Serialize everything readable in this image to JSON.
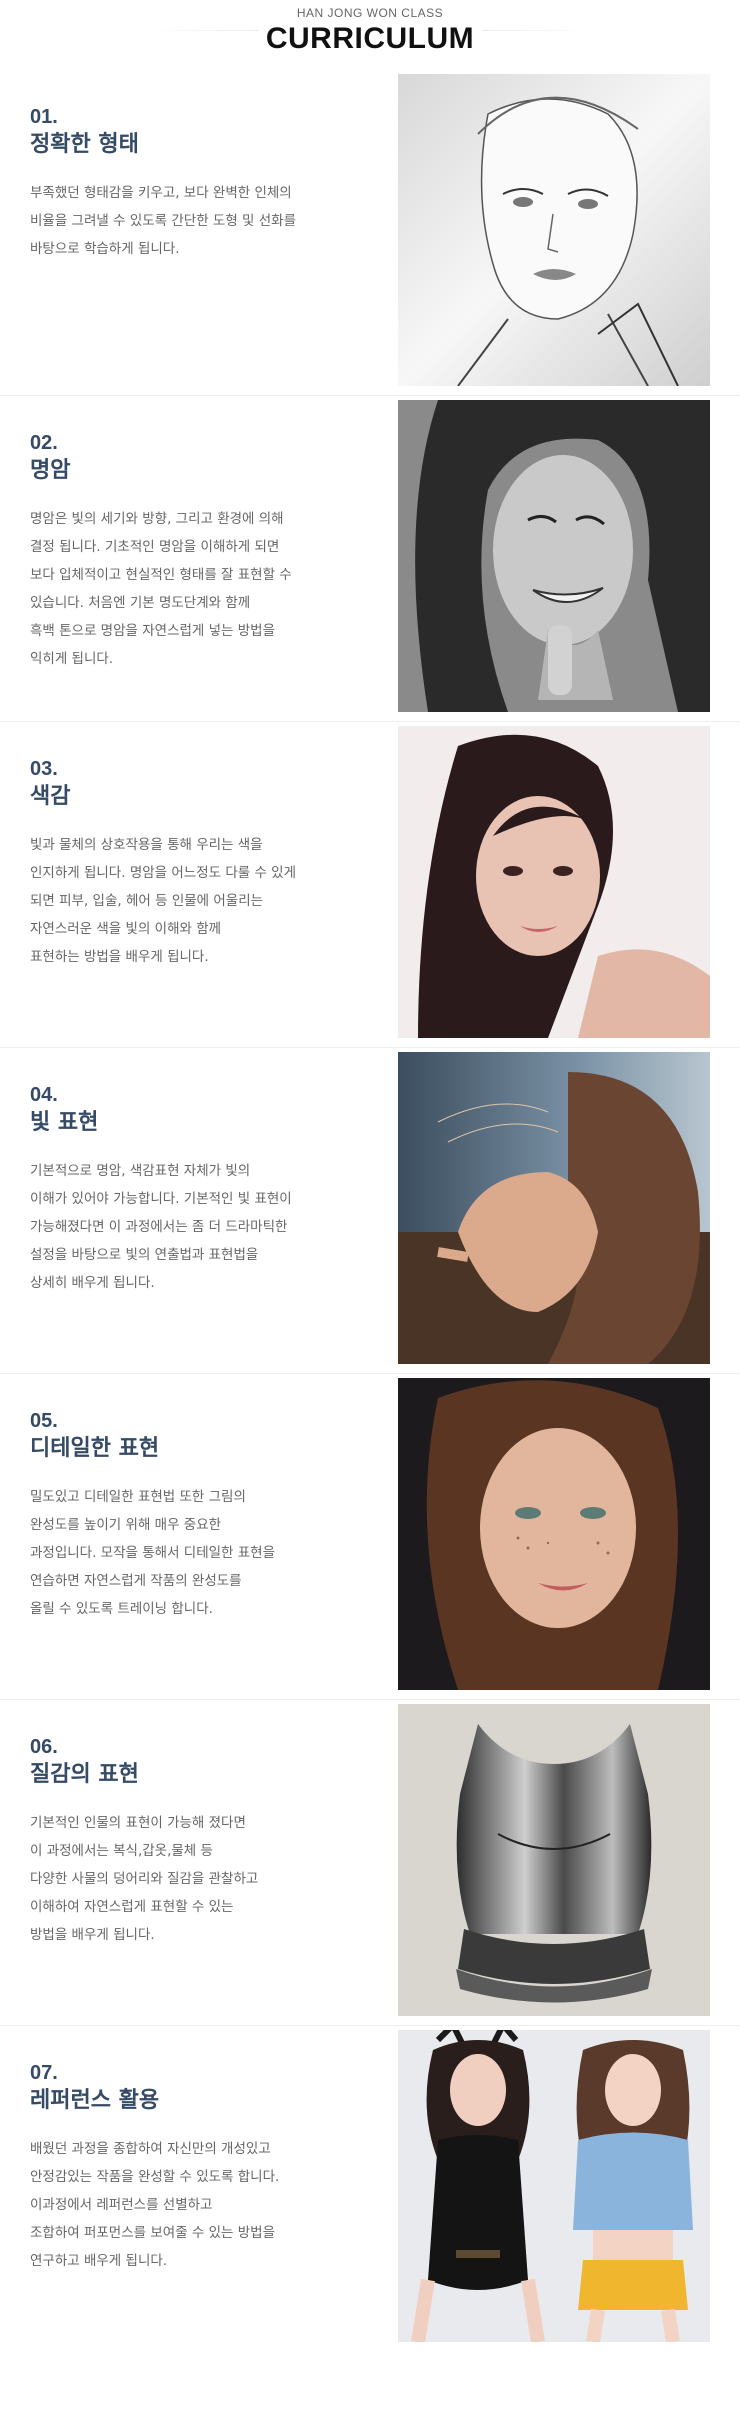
{
  "header": {
    "subtitle": "HAN JONG WON CLASS",
    "title": "CURRICULUM"
  },
  "sections": [
    {
      "number": "01.",
      "title": "정확한 형태",
      "description": "부족했던 형태감을 키우고, 보다 완벽한 인체의\n비율을 그려낼 수 있도록  간단한 도형 및 선화를\n바탕으로 학습하게 됩니다.",
      "image": "pencil-sketch-portrait"
    },
    {
      "number": "02.",
      "title": "명암",
      "description": "명암은 빛의 세기와 방향, 그리고 환경에 의해\n결정 됩니다. 기초적인 명암을 이해하게 되면\n보다 입체적이고 현실적인 형태를 잘 표현할 수\n있습니다.  처음엔 기본 명도단계와 함께\n흑백 톤으로 명암을 자연스럽게 넣는 방법을\n익히게 됩니다.",
      "image": "grayscale-smiling-portrait"
    },
    {
      "number": "03.",
      "title": "색감",
      "description": "빛과 물체의 상호작용을 통해 우리는 색을\n인지하게 됩니다. 명암을 어느정도 다룰 수 있게\n되면 피부, 입술, 헤어 등 인물에 어울리는\n자연스러운 색을 빛의 이해와 함께\n표현하는 방법을 배우게 됩니다.",
      "image": "color-portrait-dark-hair"
    },
    {
      "number": "04.",
      "title": "빛 표현",
      "description": "기본적으로 명암, 색감표현 자체가 빛의\n이해가 있어야 가능합니다. 기본적인 빛 표현이\n가능해졌다면 이 과정에서는 좀 더 드라마틱한\n설정을 바탕으로 빛의 연출법과 표현법을\n상세히 배우게 됩니다.",
      "image": "backlit-profile-portrait"
    },
    {
      "number": "05.",
      "title": "디테일한 표현",
      "description": "밀도있고 디테일한 표현법 또한 그림의\n완성도를 높이기 위해 매우 중요한\n과정입니다. 모작을 통해서 디테일한 표현을\n연습하면 자연스럽게 작품의 완성도를\n올릴 수 있도록 트레이닝 합니다.",
      "image": "freckled-portrait"
    },
    {
      "number": "06.",
      "title": "질감의 표현",
      "description": "기본적인 인물의 표현이 가능해 졌다면\n이 과정에서는 복식,갑옷,물체 등\n다양한 사물의 덩어리와 질감을 관찰하고\n이해하여 자연스럽게 표현할 수 있는\n방법을 배우게 됩니다.",
      "image": "metal-armor"
    },
    {
      "number": "07.",
      "title": "레퍼런스 활용",
      "description": "배웠던 과정을 종합하여 자신만의 개성있고\n안정감있는 작품을 완성할 수 있도록 합니다.\n이과정에서 레퍼런스를 선별하고\n조합하여 퍼포먼스를 보여줄 수 있는 방법을\n연구하고 배우게 됩니다.",
      "image": "two-figures-illustration"
    }
  ]
}
